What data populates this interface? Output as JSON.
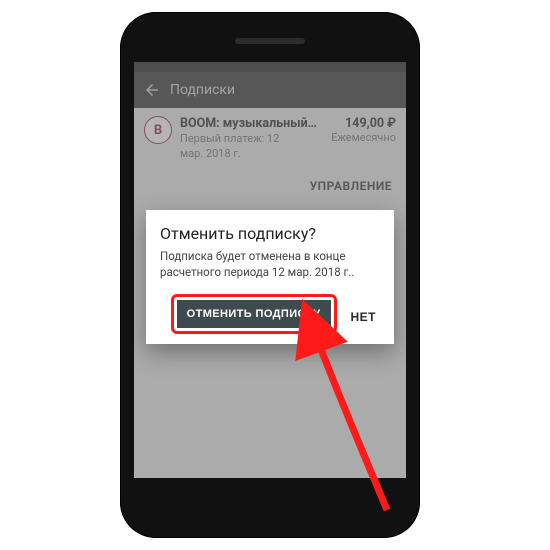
{
  "appbar": {
    "title": "Подписки"
  },
  "subscription": {
    "icon_letter": "B",
    "title": "BOOM: музыкальный…",
    "line1": "Первый платеж: 12",
    "line2": "мар. 2018 г.",
    "price": "149,00 ₽",
    "frequency": "Ежемесячно",
    "manage": "УПРАВЛЕНИЕ"
  },
  "dialog": {
    "title": "Отменить подписку?",
    "body1": "Подписка будет отменена в конце",
    "body2": "расчетного периода 12 мар. 2018 г..",
    "primary": "ОТМЕНИТЬ ПОДПИСКУ",
    "secondary": "НЕТ"
  }
}
